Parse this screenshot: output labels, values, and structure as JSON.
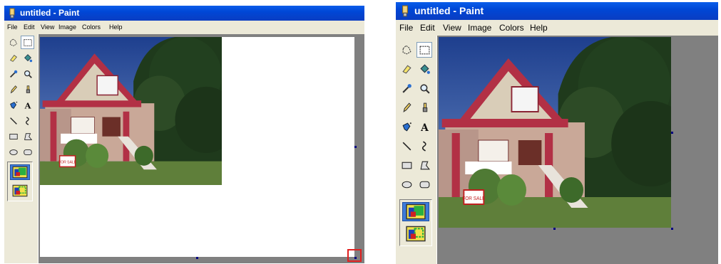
{
  "left_window": {
    "title": "untitled - Paint",
    "menu": [
      "File",
      "Edit",
      "View",
      "Image",
      "Colors",
      "Help"
    ]
  },
  "right_window": {
    "title": "untitled - Paint",
    "menu": [
      "File",
      "Edit",
      "View",
      "Image",
      "Colors",
      "Help"
    ]
  },
  "tools": [
    {
      "name": "free-form-select-icon"
    },
    {
      "name": "rectangle-select-icon"
    },
    {
      "name": "eraser-icon"
    },
    {
      "name": "fill-bucket-icon"
    },
    {
      "name": "color-picker-icon"
    },
    {
      "name": "magnifier-icon"
    },
    {
      "name": "pencil-icon"
    },
    {
      "name": "brush-icon"
    },
    {
      "name": "airbrush-icon"
    },
    {
      "name": "text-icon",
      "glyph": "A"
    },
    {
      "name": "line-icon"
    },
    {
      "name": "curve-icon"
    },
    {
      "name": "rectangle-icon"
    },
    {
      "name": "polygon-icon"
    },
    {
      "name": "ellipse-icon"
    },
    {
      "name": "rounded-rectangle-icon"
    }
  ],
  "sign_text": "FOR SALE",
  "colors": {
    "titlebar": "#0A5DEA",
    "chrome": "#ECE9D8",
    "workspace": "#808080",
    "highlight": "#E02020"
  }
}
